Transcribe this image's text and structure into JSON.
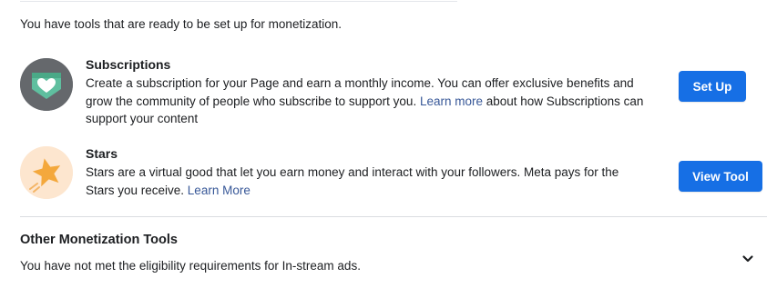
{
  "intro": "You have tools that are ready to be set up for monetization.",
  "tools": [
    {
      "title": "Subscriptions",
      "desc_pre": "Create a subscription for your Page and earn a monthly income. You can offer exclusive benefits and grow the community of people who subscribe to support you. ",
      "link": "Learn more",
      "desc_post": " about how Subscriptions can support your content",
      "button": "Set Up",
      "icon": "subscription-badge-icon"
    },
    {
      "title": "Stars",
      "desc_pre": "Stars are a virtual good that let you earn money and interact with your followers. Meta pays for the Stars you receive. ",
      "link": "Learn More",
      "desc_post": "",
      "button": "View Tool",
      "icon": "star-icon"
    }
  ],
  "other": {
    "title": "Other Monetization Tools",
    "desc": "You have not met the eligibility requirements for In-stream ads.",
    "icon": "chevron-down-icon"
  },
  "colors": {
    "button": "#166fe5",
    "link": "#385898",
    "text": "#1c1e21",
    "divider": "#dadde1"
  }
}
